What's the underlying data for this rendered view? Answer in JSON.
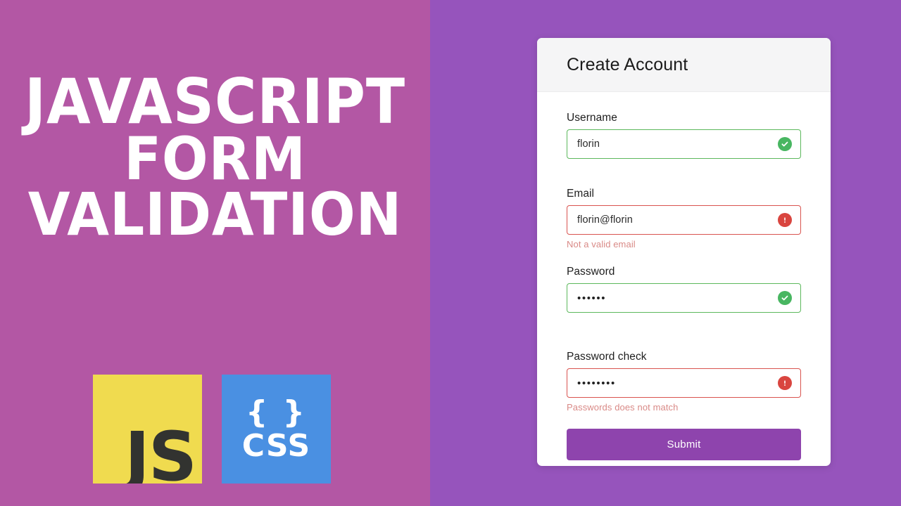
{
  "theme": {
    "left_panel_color": "#b357a4",
    "right_panel_color": "#9654bc",
    "card_background": "#ffffff",
    "card_header_background": "#f5f5f6",
    "valid_border_color": "#5cb85c",
    "invalid_border_color": "#d9534f",
    "valid_icon_color": "#48b661",
    "invalid_icon_color": "#d9453f",
    "error_text_color": "#d98a87",
    "submit_button_color": "#8e44ad",
    "js_badge_color": "#f0db4f",
    "js_text_color": "#323330",
    "css_badge_color": "#4a90e2",
    "css_text_color": "#ffffff"
  },
  "promo": {
    "title_lines": [
      "JavaScript",
      "Form",
      "Validation"
    ],
    "badges": [
      {
        "name": "javascript",
        "label": "JS",
        "symbol": ""
      },
      {
        "name": "css",
        "label": "CSS",
        "symbol": "{ }"
      }
    ]
  },
  "card": {
    "header": {
      "title": "Create Account"
    },
    "fields": [
      {
        "name": "username",
        "label": "Username",
        "value": "florin",
        "masked": false,
        "state": "valid",
        "icon": "check-circle-icon",
        "error": ""
      },
      {
        "name": "email",
        "label": "Email",
        "value": "florin@florin",
        "masked": false,
        "state": "invalid",
        "icon": "exclamation-circle-icon",
        "error": "Not a valid email"
      },
      {
        "name": "password",
        "label": "Password",
        "value": "••••••",
        "masked": true,
        "state": "valid",
        "icon": "check-circle-icon",
        "error": ""
      },
      {
        "name": "password-check",
        "label": "Password check",
        "value": "••••••••",
        "masked": true,
        "state": "invalid",
        "icon": "exclamation-circle-icon",
        "error": "Passwords does not match"
      }
    ],
    "submit": {
      "label": "Submit"
    }
  }
}
